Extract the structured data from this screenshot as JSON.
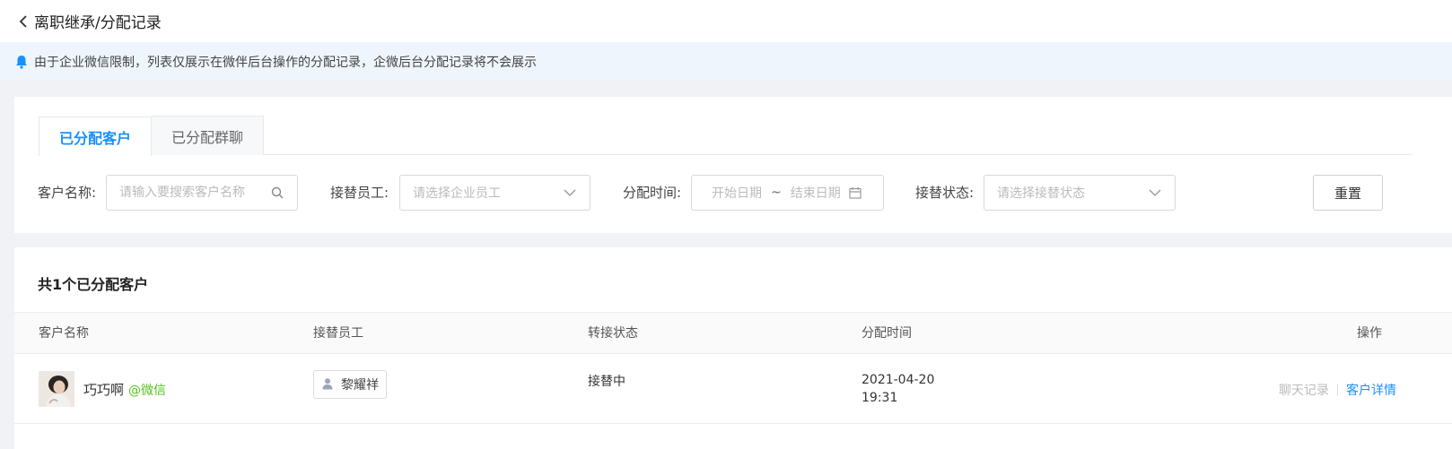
{
  "header": {
    "title": "离职继承/分配记录"
  },
  "notice": {
    "text": "由于企业微信限制，列表仅展示在微伴后台操作的分配记录，企微后台分配记录将不会展示"
  },
  "tabs": [
    {
      "label": "已分配客户",
      "active": true
    },
    {
      "label": "已分配群聊",
      "active": false
    }
  ],
  "filters": {
    "customer_name": {
      "label": "客户名称:",
      "placeholder": "请输入要搜索客户名称"
    },
    "successor": {
      "label": "接替员工:",
      "placeholder": "请选择企业员工"
    },
    "assign_time": {
      "label": "分配时间:",
      "start_placeholder": "开始日期",
      "separator": "~",
      "end_placeholder": "结束日期"
    },
    "status": {
      "label": "接替状态:",
      "placeholder": "请选择接替状态"
    },
    "reset_label": "重置"
  },
  "list": {
    "count_title": "共1个已分配客户",
    "columns": [
      "客户名称",
      "接替员工",
      "转接状态",
      "分配时间",
      "操作"
    ],
    "rows": [
      {
        "customer_name": "巧巧啊",
        "source": "@微信",
        "successor": "黎耀祥",
        "status": "接替中",
        "date": "2021-04-20",
        "time": "19:31",
        "op_chat": "聊天记录",
        "op_detail": "客户详情"
      }
    ]
  },
  "colors": {
    "accent": "#1890ff",
    "wechat_green": "#52c41a",
    "notice_bg": "#eef5fc"
  }
}
